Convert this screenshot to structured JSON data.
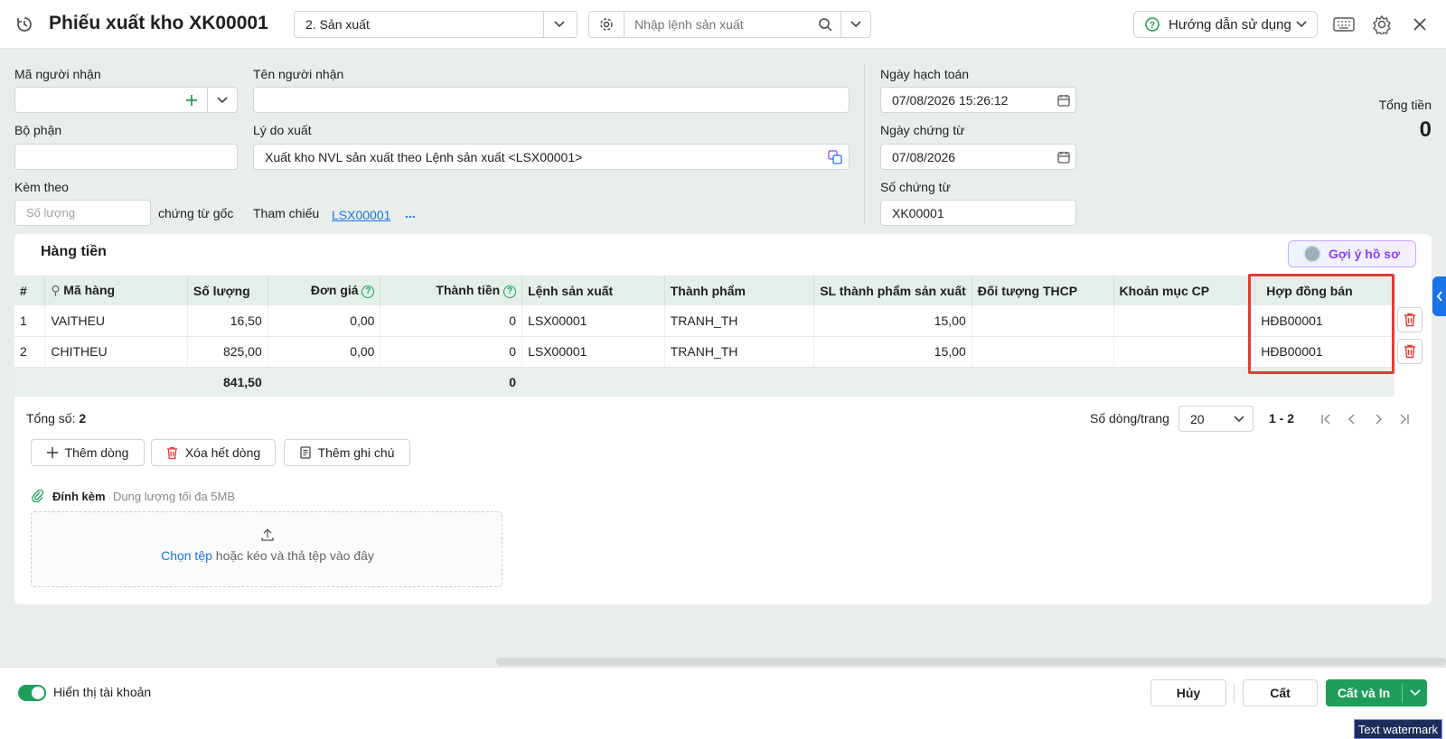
{
  "header": {
    "title": "Phiếu xuất kho XK00001",
    "type_select": "2. Sản xuất",
    "search_placeholder": "Nhập lệnh sản xuất",
    "help_label": "Hướng dẫn sử dụng"
  },
  "form": {
    "recipient_code_label": "Mã người nhận",
    "recipient_code_value": "",
    "recipient_name_label": "Tên người nhận",
    "recipient_name_value": "",
    "department_label": "Bộ phận",
    "department_value": "",
    "reason_label": "Lý do xuất",
    "reason_value": "Xuất kho NVL sản xuất theo Lệnh sản xuất <LSX00001>",
    "attach_label": "Kèm theo",
    "attach_placeholder": "Số lượng",
    "attach_suffix": "chứng từ gốc",
    "reference_label": "Tham chiếu",
    "reference_link": "LSX00001",
    "reference_more": "...",
    "posting_date_label": "Ngày hạch toán",
    "posting_date_value": "07/08/2026 15:26:12",
    "doc_date_label": "Ngày chứng từ",
    "doc_date_value": "07/08/2026",
    "doc_no_label": "Số chứng từ",
    "doc_no_value": "XK00001",
    "total_label": "Tổng tiền",
    "total_value": "0"
  },
  "section": {
    "title": "Hàng tiền",
    "suggest_label": "Gợi ý hồ sơ"
  },
  "table": {
    "headers": [
      "#",
      "Mã hàng",
      "Số lượng",
      "Đơn giá",
      "Thành tiền",
      "Lệnh sản xuất",
      "Thành phẩm",
      "SL thành phẩm sản xuất",
      "Đối tượng THCP",
      "Khoản mục CP",
      "Hợp đồng bán"
    ],
    "rows": [
      {
        "no": "1",
        "code": "VAITHEU",
        "qty": "16,50",
        "price": "0,00",
        "amount": "0",
        "order": "LSX00001",
        "product": "TRANH_TH",
        "product_qty": "15,00",
        "cost_object": "",
        "cost_item": "",
        "contract": "HĐB00001"
      },
      {
        "no": "2",
        "code": "CHITHEU",
        "qty": "825,00",
        "price": "0,00",
        "amount": "0",
        "order": "LSX00001",
        "product": "TRANH_TH",
        "product_qty": "15,00",
        "cost_object": "",
        "cost_item": "",
        "contract": "HĐB00001"
      }
    ],
    "sum_qty": "841,50",
    "sum_amount": "0"
  },
  "pagination": {
    "total_label": "Tổng số:",
    "total_value": "2",
    "per_page_label": "Số dòng/trang",
    "per_page_value": "20",
    "range": "1 - 2"
  },
  "actions": {
    "add_row": "Thêm dòng",
    "delete_all": "Xóa hết dòng",
    "add_note": "Thêm ghi chú"
  },
  "attachment": {
    "label": "Đính kèm",
    "hint": "Dung lượng tối đa 5MB",
    "choose": "Chọn tệp",
    "drop_text": "hoặc kéo và thả tệp vào đây"
  },
  "footer": {
    "toggle_label": "Hiển thị tài khoản",
    "cancel": "Hủy",
    "save": "Cất",
    "save_print": "Cất và In"
  },
  "watermark": "Text watermark",
  "colors": {
    "accent": "#1e9e5a",
    "link": "#1a73e8",
    "danger": "#e53935",
    "highlight_border": "#e53935",
    "suggest": "#8a3ffc"
  }
}
